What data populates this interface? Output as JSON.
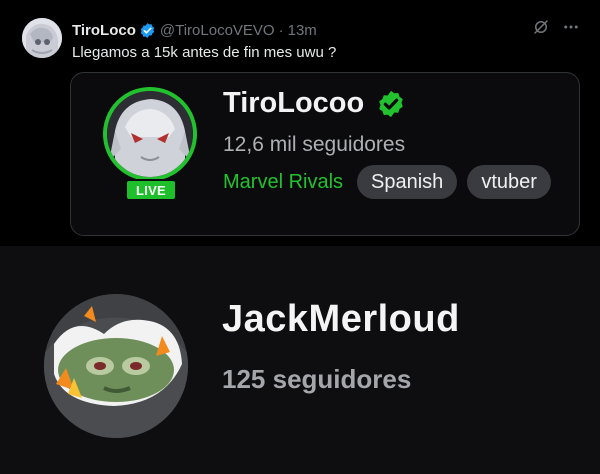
{
  "tweet": {
    "display_name": "TiroLoco",
    "handle": "@TiroLocoVEVO",
    "separator": "·",
    "time": "13m",
    "text": "Llegamos a 15k antes de fin mes uwu ?"
  },
  "stream_card": {
    "channel_name": "TiroLocoo",
    "followers": "12,6 mil seguidores",
    "live_label": "LIVE",
    "category": "Marvel Rivals",
    "tags": [
      "Spanish",
      "vtuber"
    ]
  },
  "profile": {
    "channel_name": "JackMerloud",
    "followers": "125 seguidores"
  },
  "colors": {
    "twitch_live_green": "#22c22e",
    "twitter_verified_blue": "#1d9bf0",
    "muted_text": "#71767b"
  },
  "icons": [
    "verified-badge-icon",
    "grok-icon",
    "more-icon",
    "twitch-verified-icon"
  ]
}
